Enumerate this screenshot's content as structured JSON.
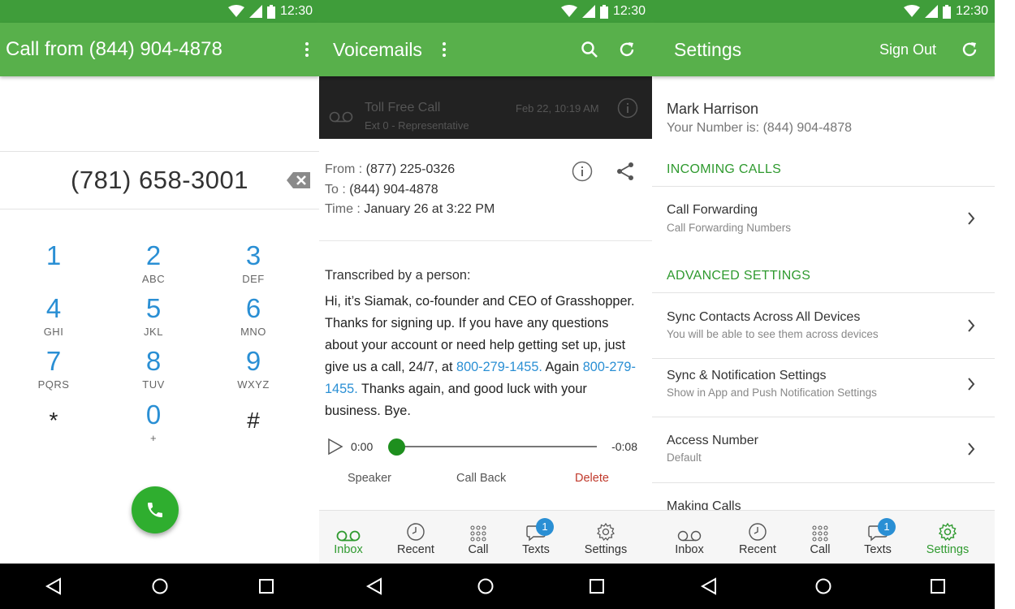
{
  "status_time": "12:30",
  "screen_call": {
    "title": "Call from (844) 904-4878",
    "dialed_number": "(781) 658-3001",
    "keys": [
      {
        "digit": "1",
        "letters": ""
      },
      {
        "digit": "2",
        "letters": "ABC"
      },
      {
        "digit": "3",
        "letters": "DEF"
      },
      {
        "digit": "4",
        "letters": "GHI"
      },
      {
        "digit": "5",
        "letters": "JKL"
      },
      {
        "digit": "6",
        "letters": "MNO"
      },
      {
        "digit": "7",
        "letters": "PQRS"
      },
      {
        "digit": "8",
        "letters": "TUV"
      },
      {
        "digit": "9",
        "letters": "WXYZ"
      },
      {
        "digit": "*",
        "letters": ""
      },
      {
        "digit": "0",
        "letters": "+"
      },
      {
        "digit": "#",
        "letters": ""
      }
    ]
  },
  "screen_voicemail": {
    "title": "Voicemails",
    "list_item": {
      "name": "Toll Free Call",
      "sub": "Ext 0 - Representative",
      "date": "Feb 22, 10:19 AM"
    },
    "from_label": "From :",
    "from": "(877) 225-0326",
    "to_label": "To :",
    "to": "(844) 904-4878",
    "time_label": "Time :",
    "time": "January 26 at 3:22 PM",
    "transcribed_by": "Transcribed by a person:",
    "transcript_1": "Hi, it’s Siamak, co-founder and CEO of Grasshopper. Thanks for signing up. If you have any questions about your account or need help getting set up, just give us a call, 24/7, at ",
    "transcript_link1": "800-279-1455.",
    "transcript_2": " Again ",
    "transcript_link2": "800-279-1455.",
    "transcript_3": " Thanks again, and good luck with your business. Bye.",
    "elapsed": "0:00",
    "remaining": "-0:08",
    "speaker": "Speaker",
    "call_back": "Call Back",
    "delete": "Delete"
  },
  "screen_settings": {
    "title": "Settings",
    "sign_out": "Sign Out",
    "user_name": "Mark Harrison",
    "your_number": "Your Number is: (844) 904-4878",
    "incoming_header": "INCOMING CALLS",
    "advanced_header": "ADVANCED SETTINGS",
    "call_forwarding": {
      "title": "Call Forwarding",
      "sub": "Call Forwarding Numbers"
    },
    "sync_contacts": {
      "title": "Sync Contacts Across All Devices",
      "sub": "You will be able to see them across devices"
    },
    "sync_notifications": {
      "title": "Sync & Notification Settings",
      "sub": "Show in App and Push Notification Settings"
    },
    "access_number": {
      "title": "Access Number",
      "sub": "Default"
    },
    "making_calls": {
      "title": "Making Calls"
    }
  },
  "tabs": {
    "inbox": "Inbox",
    "recent": "Recent",
    "call": "Call",
    "texts": "Texts",
    "settings": "Settings",
    "texts_badge": "1"
  },
  "colors": {
    "appbar": "#58b04b",
    "statusbar": "#3f9d3a",
    "accent_green": "#2f9a2f",
    "link_blue": "#2a8fd4",
    "delete_red": "#c0392b",
    "call_button": "#2fae2f"
  }
}
